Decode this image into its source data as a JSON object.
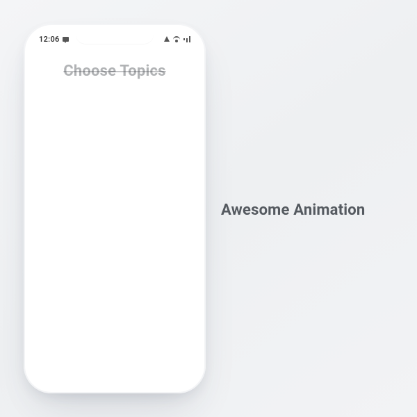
{
  "statusBar": {
    "time": "12:06",
    "icons": {
      "chat": "chat-bubble-icon",
      "alert": "alert-triangle-icon",
      "wifi": "wifi-icon",
      "signal": "cellular-signal-icon"
    }
  },
  "screen": {
    "heading": "Choose Topics"
  },
  "caption": "Awesome Animation"
}
